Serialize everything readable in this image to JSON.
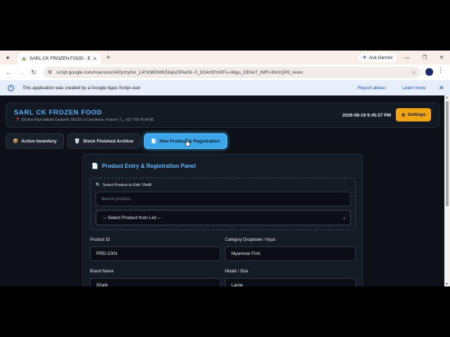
{
  "browser": {
    "tab_title": "SARL CK FROZEN FOOD - Ente",
    "new_tab": "+",
    "gemini_label": "Ask Gemini",
    "url": "script.google.com/macros/s/AKfycby0vr_LiP1hBDh9K5lIqluOPlaISL-0_3O4z0FmEFu-vl6gu_DENx7_tMFL45nzQP6_/exec"
  },
  "infobar": {
    "message": "This application was created by a Google Apps Script user",
    "report_abuse": "Report abuse",
    "learn_more": "Learn more"
  },
  "header": {
    "brand": "SARL CK FROZEN FOOD",
    "address": "160 Ave Paul Vaillant Couturier, 93120 La Courneuve, France |",
    "phone": "+33 7 58 76 64 88",
    "datetime": "2026-08-18 9:45:27 PM",
    "settings_label": "Settings"
  },
  "tabs": [
    {
      "label": "Active Inventory",
      "icon": "box-icon"
    },
    {
      "label": "Stock Finished Archive",
      "icon": "trash-icon"
    },
    {
      "label": "New Product & Registration",
      "icon": "document-icon",
      "active": true
    }
  ],
  "panel": {
    "title": "Product Entry & Registration Panel",
    "select_label": "Select Product to Edit / Refill",
    "search_placeholder": "Search product...",
    "dropdown_value": "-- Select Product from List --",
    "fields": {
      "product_id_label": "Product ID",
      "product_id_value": "PRD-1001",
      "category_label": "Category Dropdown / Input",
      "category_value": "Myanmar Fish",
      "brand_label": "Brand Name",
      "brand_value": "Shahi",
      "model_label": "Model / Size",
      "model_value": "Large"
    }
  },
  "colors": {
    "accent": "#3ba7ea",
    "brand": "#4fb3ff",
    "settings": "#f0a512",
    "background": "#0d1016"
  }
}
